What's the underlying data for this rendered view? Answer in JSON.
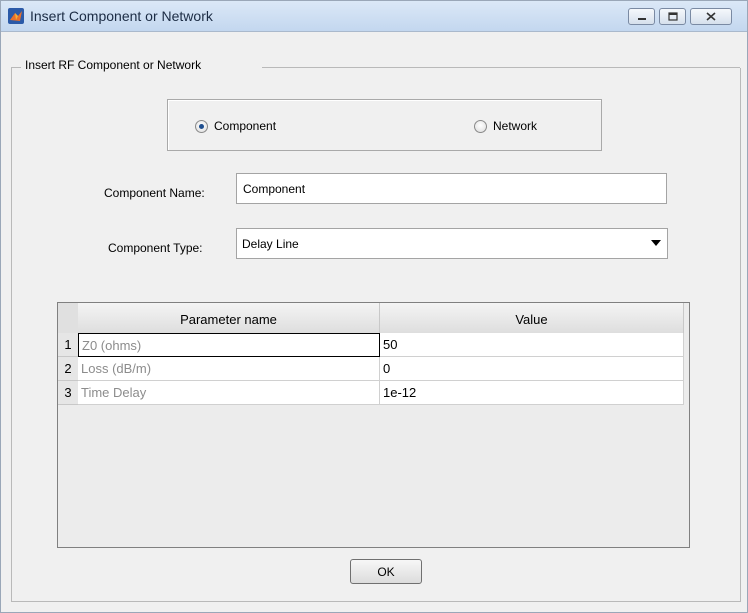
{
  "window": {
    "title": "Insert Component or Network"
  },
  "group": {
    "label": "Insert RF Component or Network"
  },
  "mode": {
    "options": [
      {
        "label": "Component",
        "selected": true
      },
      {
        "label": "Network",
        "selected": false
      }
    ]
  },
  "form": {
    "name_label": "Component Name:",
    "name_value": "Component",
    "type_label": "Component Type:",
    "type_value": "Delay Line"
  },
  "table": {
    "headers": [
      "Parameter name",
      "Value"
    ],
    "rows": [
      {
        "num": "1",
        "name": "Z0 (ohms)",
        "value": "50"
      },
      {
        "num": "2",
        "name": "Loss (dB/m)",
        "value": "0"
      },
      {
        "num": "3",
        "name": "Time Delay",
        "value": "1e-12"
      }
    ]
  },
  "footer": {
    "ok_label": "OK"
  }
}
